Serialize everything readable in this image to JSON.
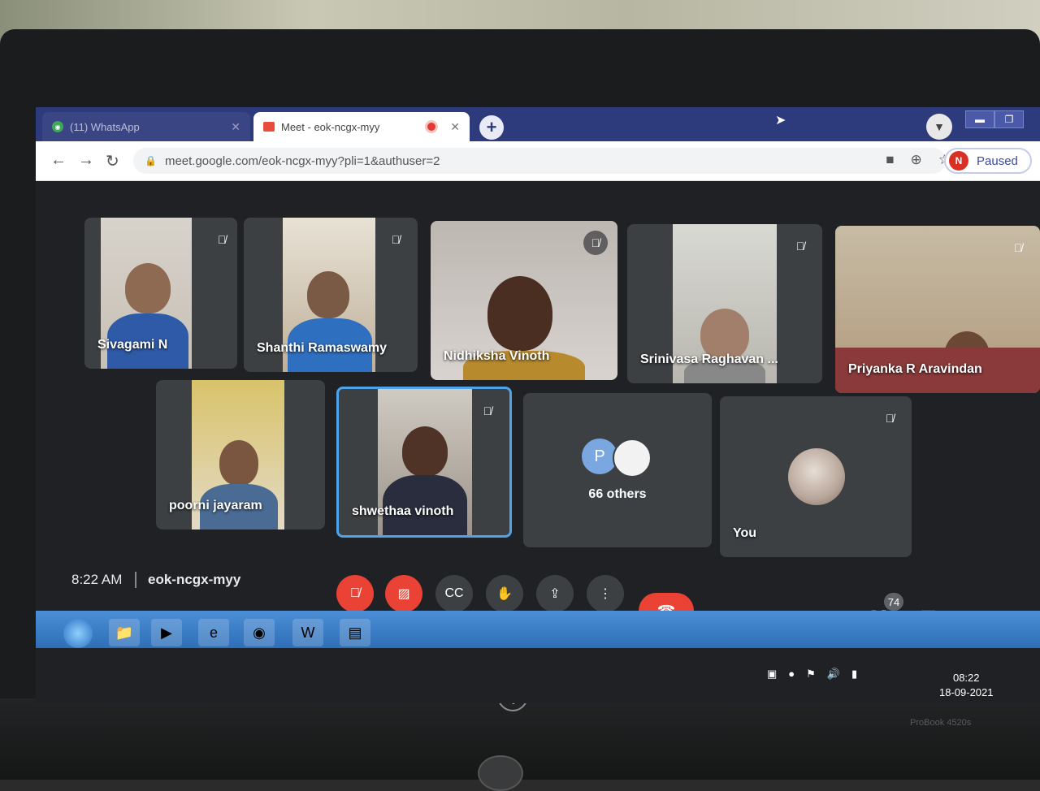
{
  "browser": {
    "tabs": [
      {
        "label": "(11) WhatsApp",
        "badge": "11"
      },
      {
        "label": "Meet - eok-ncgx-myy"
      }
    ],
    "url": "meet.google.com/eok-ncgx-myy?pli=1&authuser=2",
    "profile": {
      "initial": "N",
      "status": "Paused"
    }
  },
  "meeting": {
    "participants": [
      {
        "name": "Sivagami N",
        "muted": true
      },
      {
        "name": "Shanthi Ramaswamy",
        "muted": true
      },
      {
        "name": "Nidhiksha Vinoth",
        "muted": true
      },
      {
        "name": "Srinivasa Raghavan ...",
        "muted": true
      },
      {
        "name": "Priyanka R Aravindan",
        "muted": true
      },
      {
        "name": "poorni jayaram",
        "muted": false
      },
      {
        "name": "shwethaa vinoth",
        "muted": true,
        "speaking_highlight": true
      }
    ],
    "others": {
      "initial": "P",
      "label": "66 others"
    },
    "self": {
      "label": "You",
      "muted": true
    },
    "time": "8:22 AM",
    "code": "eok-ncgx-myy",
    "people_count": "74"
  },
  "taskbar": {
    "clock_time": "08:22",
    "clock_date": "18-09-2021"
  },
  "device": {
    "brand": "hp",
    "model": "ProBook 4520s"
  },
  "colors": {
    "tab_bar": "#2d3a7c",
    "meet_bg": "#202124",
    "tile": "#3c4043",
    "danger": "#ea4335",
    "highlight": "#4fa3e8"
  }
}
